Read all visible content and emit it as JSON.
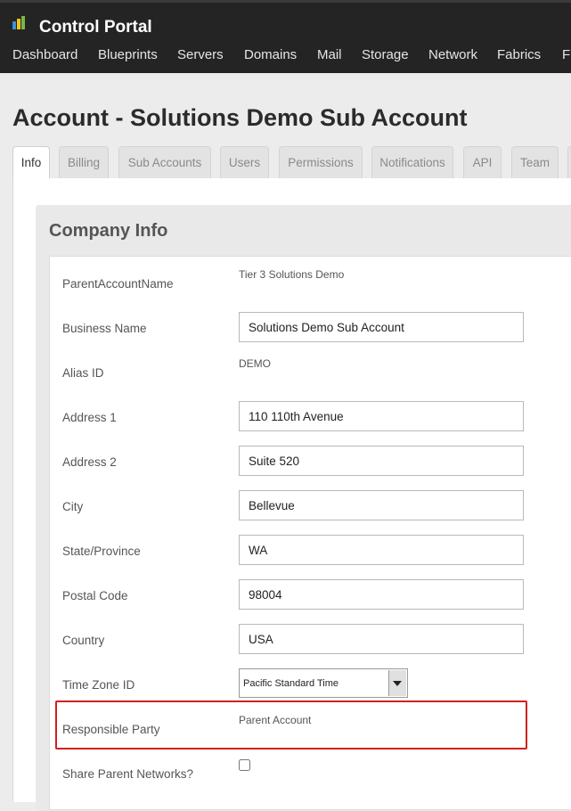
{
  "app": {
    "title": "Control Portal"
  },
  "nav": {
    "items": [
      "Dashboard",
      "Blueprints",
      "Servers",
      "Domains",
      "Mail",
      "Storage",
      "Network",
      "Fabrics",
      "F"
    ]
  },
  "page": {
    "title": "Account - Solutions Demo Sub Account"
  },
  "tabs": [
    "Info",
    "Billing",
    "Sub Accounts",
    "Users",
    "Permissions",
    "Notifications",
    "API",
    "Team"
  ],
  "company_info": {
    "title": "Company Info",
    "parent_account_name": {
      "label": "ParentAccountName",
      "value": "Tier 3 Solutions Demo"
    },
    "business_name": {
      "label": "Business Name",
      "value": "Solutions Demo Sub Account"
    },
    "alias_id": {
      "label": "Alias ID",
      "value": "DEMO"
    },
    "address1": {
      "label": "Address 1",
      "value": "110 110th Avenue"
    },
    "address2": {
      "label": "Address 2",
      "value": "Suite 520"
    },
    "city": {
      "label": "City",
      "value": "Bellevue"
    },
    "state": {
      "label": "State/Province",
      "value": "WA"
    },
    "postal_code": {
      "label": "Postal Code",
      "value": "98004"
    },
    "country": {
      "label": "Country",
      "value": "USA"
    },
    "time_zone": {
      "label": "Time Zone ID",
      "value": "Pacific Standard Time"
    },
    "responsible_party": {
      "label": "Responsible Party",
      "value": "Parent Account"
    },
    "share_parent_networks": {
      "label": "Share Parent Networks?",
      "checked": false
    }
  },
  "colors": {
    "topbar": "#242424",
    "highlight_border": "#d32020",
    "logo_bars": [
      "#3d8fd6",
      "#f0c419",
      "#7ab648"
    ]
  },
  "icons": {
    "logo": "bar-chart-logo-icon",
    "select_arrow": "triangle-down-icon"
  }
}
